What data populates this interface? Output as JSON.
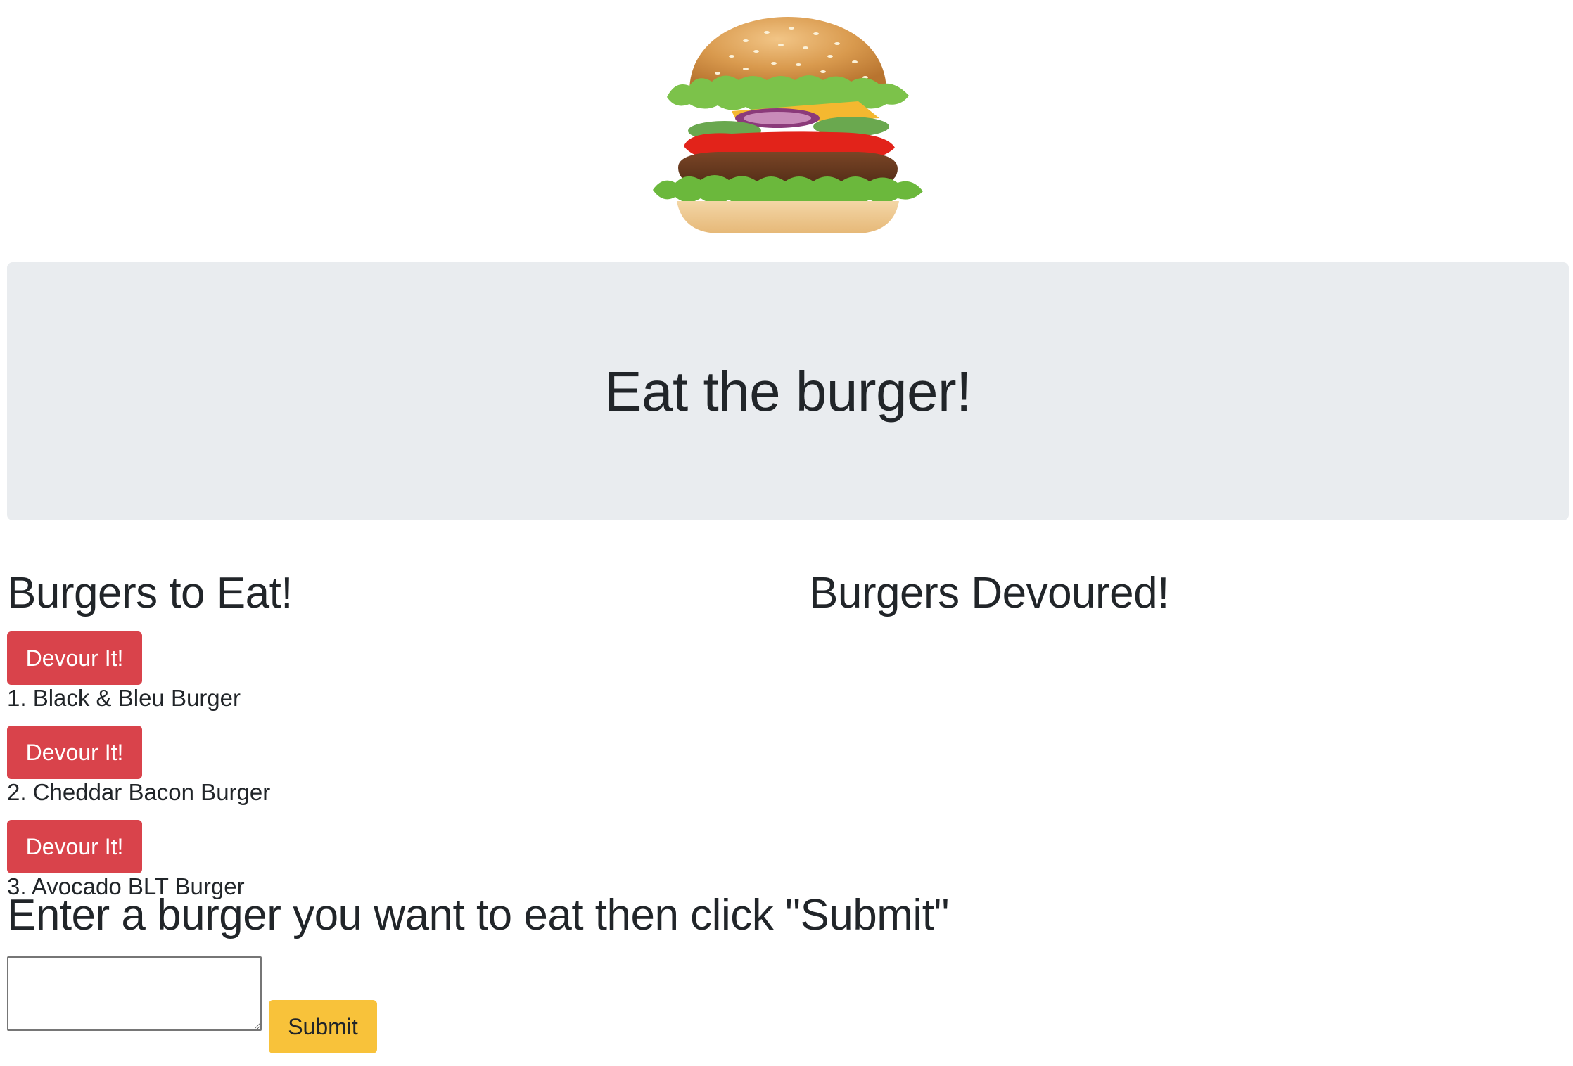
{
  "header": {
    "image_icon": "hamburger-icon"
  },
  "jumbotron": {
    "title": "Eat the burger!"
  },
  "to_eat": {
    "heading": "Burgers to Eat!",
    "button_label": "Devour It!",
    "items": [
      {
        "label": "1. Black & Bleu Burger"
      },
      {
        "label": "2. Cheddar Bacon Burger"
      },
      {
        "label": "3. Avocado BLT Burger"
      }
    ]
  },
  "devoured": {
    "heading": "Burgers Devoured!",
    "items": []
  },
  "form": {
    "heading": "Enter a burger you want to eat then click \"Submit\"",
    "input_value": "",
    "submit_label": "Submit"
  },
  "colors": {
    "jumbotron_bg": "#e9ecef",
    "devour_button": "#d9434b",
    "submit_button": "#f8c23a",
    "text": "#212529"
  }
}
